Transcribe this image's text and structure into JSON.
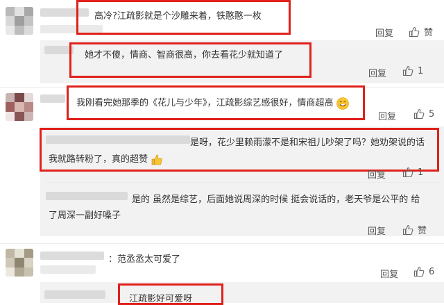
{
  "colors": {
    "highlight_border": "#e0201a",
    "reply_bg": "#f2f2f2",
    "text": "#333333",
    "meta": "#555555"
  },
  "comments": [
    {
      "text": "高冷?江疏影就是个沙雕来着，铁憨憨一枚",
      "reply": "回复",
      "likes": "赞"
    },
    {
      "text": "她才不傻，情商、智商很高，你去看花少就知道了",
      "reply": "回复",
      "likes": "1"
    },
    {
      "text": "我刚看完她那季的《花儿与少年》，江疏影综艺感很好，情商超高",
      "emoji": "smile",
      "reply": "回复",
      "likes": "5"
    },
    {
      "text_line1": "是呀，花少里赖雨濛不是和宋祖儿吵架了吗？她劝架说的话",
      "text_line2": "我就路转粉了，真的超赞",
      "emoji": "thumbs-up",
      "reply": "回复",
      "likes": "1"
    },
    {
      "text_line1": "是的 虽然是综艺，后面她说周深的时候 挺会说话的，老天爷是公平的 给",
      "text_line2": "了周深一副好嗓子",
      "reply": "回复",
      "likes": "赞"
    },
    {
      "text": "：范丞丞太可爱了",
      "reply": "回复",
      "likes": "6"
    },
    {
      "text": "江疏影好可爱呀"
    }
  ]
}
